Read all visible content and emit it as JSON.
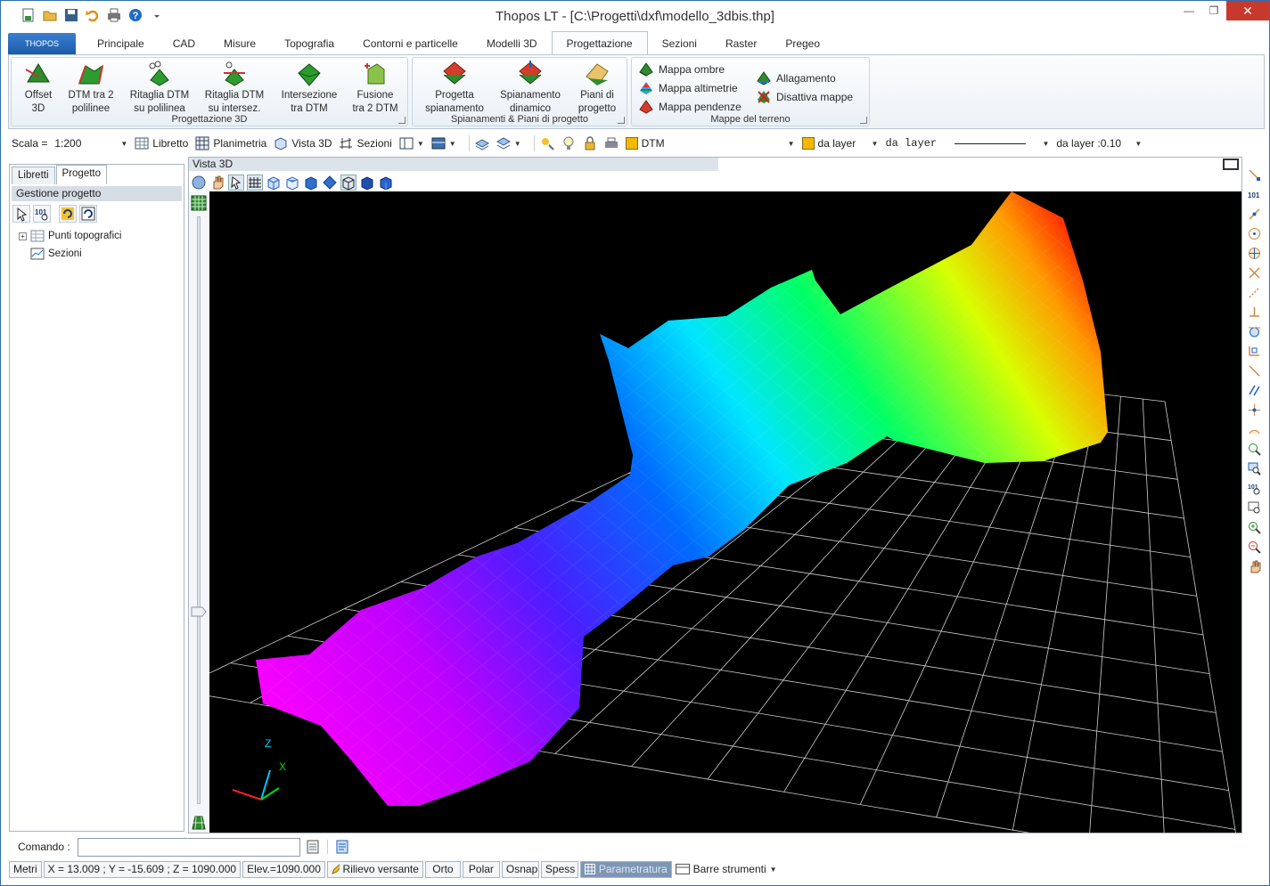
{
  "window": {
    "title": "Thopos LT - [C:\\Progetti\\dxf\\modello_3dbis.thp]"
  },
  "app_button": {
    "label": "THOPOS"
  },
  "ribbon": {
    "tabs": [
      "Principale",
      "CAD",
      "Misure",
      "Topografia",
      "Contorni e particelle",
      "Modelli 3D",
      "Progettazione",
      "Sezioni",
      "Raster",
      "Pregeo"
    ],
    "active_tab": "Progettazione",
    "groups": {
      "progettazione3d": {
        "title": "Progettazione 3D",
        "buttons": [
          {
            "label1": "Offset",
            "label2": "3D"
          },
          {
            "label1": "DTM tra 2",
            "label2": "polilinee"
          },
          {
            "label1": "Ritaglia DTM",
            "label2": "su polilinea"
          },
          {
            "label1": "Ritaglia DTM",
            "label2": "su intersez."
          },
          {
            "label1": "Intersezione",
            "label2": "tra DTM"
          },
          {
            "label1": "Fusione",
            "label2": "tra 2 DTM"
          }
        ]
      },
      "spianamenti": {
        "title": "Spianamenti & Piani di progetto",
        "buttons": [
          {
            "label1": "Progetta",
            "label2": "spianamento"
          },
          {
            "label1": "Spianamento",
            "label2": "dinamico"
          },
          {
            "label1": "Piani di",
            "label2": "progetto"
          }
        ]
      },
      "mappe": {
        "title": "Mappe del terreno",
        "buttons": [
          "Mappa ombre",
          "Mappa altimetrie",
          "Mappa pendenze",
          "Allagamento",
          "Disattiva mappe"
        ]
      }
    }
  },
  "format_toolbar": {
    "scale_label": "Scala =",
    "scale_value": "1:200",
    "libretto": "Libretto",
    "planimetria": "Planimetria",
    "vista3d": "Vista 3D",
    "sezioni": "Sezioni",
    "layer": "DTM",
    "color": "da layer",
    "linetype": "da layer",
    "lineweight": "da layer :0.10"
  },
  "left_panel": {
    "tabs": [
      "Libretti",
      "Progetto"
    ],
    "active_tab": "Progetto",
    "header": "Gestione progetto",
    "tree": [
      "Punti topografici",
      "Sezioni"
    ]
  },
  "view3d": {
    "title": "Vista 3D",
    "axes": {
      "z": "Z",
      "x": "X"
    }
  },
  "command": {
    "label": "Comando :",
    "value": ""
  },
  "status": {
    "units": "Metri",
    "coords": "X = 13.009 ; Y = -15.609 ; Z = 1090.000",
    "elev": "Elev.=1090.000",
    "mode": "Rilievo versante",
    "toggles": [
      "Orto",
      "Polar",
      "Osnap",
      "Spess",
      "Parametratura"
    ],
    "active_toggle": "Parametratura",
    "toolbars": "Barre strumenti"
  },
  "colors": {
    "accent": "#1c5aa9",
    "canvas_bg": "#000000",
    "grid": "#cfcfcf"
  }
}
